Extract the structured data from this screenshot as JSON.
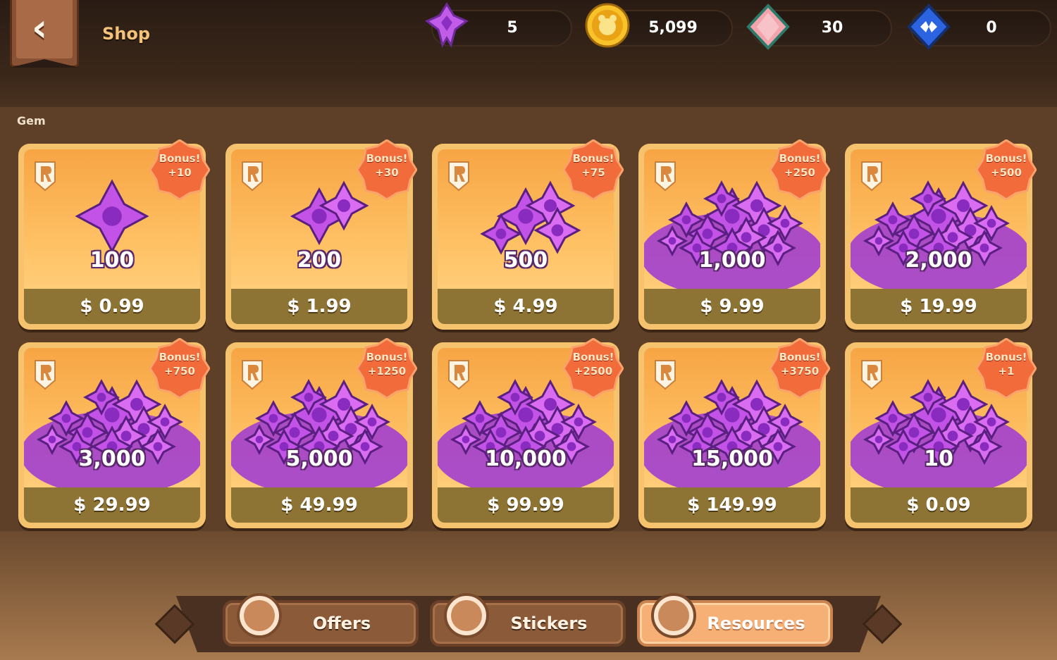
{
  "header": {
    "title": "Shop",
    "currencies": [
      {
        "name": "gem",
        "icon": "purple-gem-icon",
        "value": "5",
        "color": "#b84ae0"
      },
      {
        "name": "coin",
        "icon": "gold-coin-icon",
        "value": "5,099",
        "color": "#f5b81f"
      },
      {
        "name": "crystal",
        "icon": "pink-crystal-icon",
        "value": "30",
        "color": "#e88a9a"
      },
      {
        "name": "token",
        "icon": "blue-token-icon",
        "value": "0",
        "color": "#2a5ed8"
      }
    ]
  },
  "section": {
    "label": "Gem"
  },
  "products": [
    {
      "amount": "100",
      "price": "$ 0.99",
      "bonus_title": "Bonus!",
      "bonus_value": "+10"
    },
    {
      "amount": "200",
      "price": "$ 1.99",
      "bonus_title": "Bonus!",
      "bonus_value": "+30"
    },
    {
      "amount": "500",
      "price": "$ 4.99",
      "bonus_title": "Bonus!",
      "bonus_value": "+75"
    },
    {
      "amount": "1,000",
      "price": "$ 9.99",
      "bonus_title": "Bonus!",
      "bonus_value": "+250"
    },
    {
      "amount": "2,000",
      "price": "$ 19.99",
      "bonus_title": "Bonus!",
      "bonus_value": "+500"
    },
    {
      "amount": "3,000",
      "price": "$ 29.99",
      "bonus_title": "Bonus!",
      "bonus_value": "+750"
    },
    {
      "amount": "5,000",
      "price": "$ 49.99",
      "bonus_title": "Bonus!",
      "bonus_value": "+1250"
    },
    {
      "amount": "10,000",
      "price": "$ 99.99",
      "bonus_title": "Bonus!",
      "bonus_value": "+2500"
    },
    {
      "amount": "15,000",
      "price": "$ 149.99",
      "bonus_title": "Bonus!",
      "bonus_value": "+3750"
    },
    {
      "amount": "10",
      "price": "$ 0.09",
      "bonus_title": "Bonus!",
      "bonus_value": "+1"
    }
  ],
  "tabs": [
    {
      "label": "Offers",
      "icon": "stars-icon",
      "active": false
    },
    {
      "label": "Stickers",
      "icon": "cat-face-icon",
      "active": false
    },
    {
      "label": "Resources",
      "icon": "resource-cookie-icon",
      "active": true
    }
  ],
  "colors": {
    "accent": "#f6b075",
    "card": "#f5c36d",
    "price_bar": "#8e7434",
    "bonus_badge": "#f26b3a"
  }
}
